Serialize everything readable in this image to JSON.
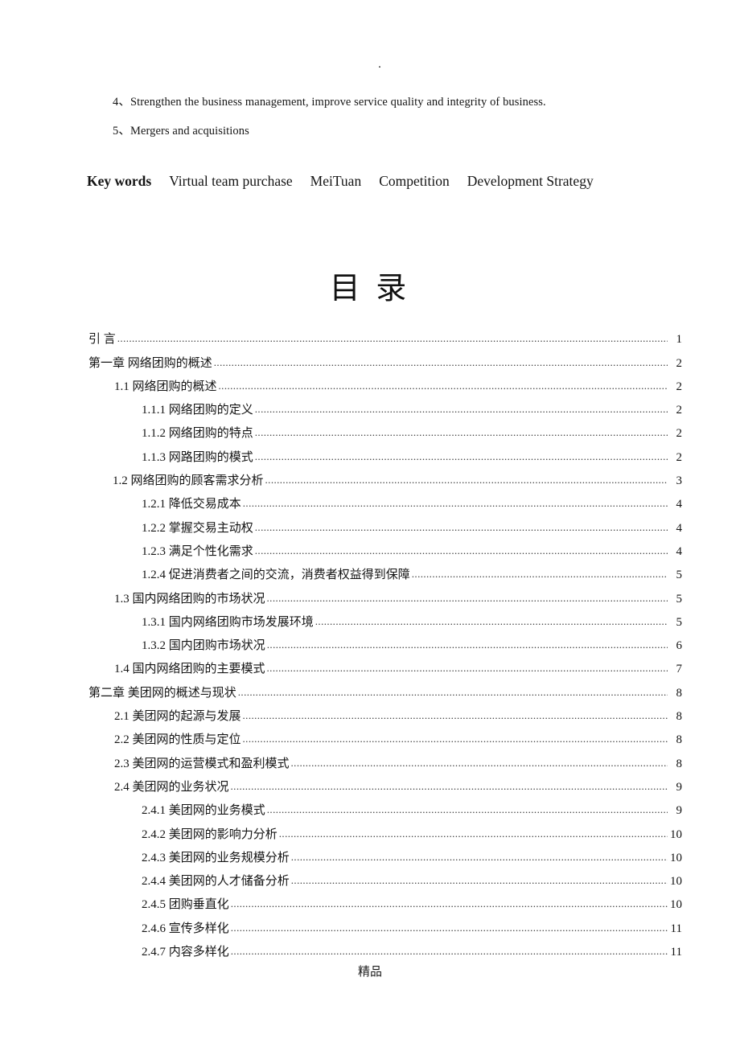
{
  "page": {
    "top_marker": ".",
    "footer_text": "精品"
  },
  "abstract_tail": {
    "lines": [
      "4、Strengthen the business management, improve service quality and integrity of business.",
      "5、Mergers and acquisitions"
    ]
  },
  "keywords": {
    "label": "Key words",
    "items": [
      "Virtual team purchase",
      "MeiTuan",
      "Competition",
      "Development Strategy"
    ]
  },
  "toc": {
    "heading": "目 录",
    "leader_char": ".",
    "entries": [
      {
        "level": 0,
        "title": "引   言",
        "page": "1"
      },
      {
        "level": 0,
        "title": "第一章  网络团购的概述",
        "page": "2"
      },
      {
        "level": 1,
        "title": "1.1  网络团购的概述",
        "page": "2"
      },
      {
        "level": 2,
        "title": "1.1.1 网络团购的定义",
        "page": "2"
      },
      {
        "level": 2,
        "title": "1.1.2 网络团购的特点",
        "page": "2"
      },
      {
        "level": 2,
        "title": "1.1.3 网路团购的模式",
        "page": "2"
      },
      {
        "level": 1,
        "title": "1.2 网络团购的顾客需求分析",
        "page": "3"
      },
      {
        "level": 2,
        "title": "1.2.1 降低交易成本",
        "page": "4"
      },
      {
        "level": 2,
        "title": "1.2.2 掌握交易主动权",
        "page": "4"
      },
      {
        "level": 2,
        "title": "1.2.3 满足个性化需求",
        "page": "4"
      },
      {
        "level": 2,
        "title": "1.2.4 促进消费者之间的交流，消费者权益得到保障",
        "page": "5"
      },
      {
        "level": 1,
        "title": "1.3  国内网络团购的市场状况",
        "page": "5"
      },
      {
        "level": 2,
        "title": "1.3.1 国内网络团购市场发展环境",
        "page": "5"
      },
      {
        "level": 2,
        "title": "1.3.2 国内团购市场状况",
        "page": "6"
      },
      {
        "level": 1,
        "title": "1.4  国内网络团购的主要模式",
        "page": "7"
      },
      {
        "level": 0,
        "title": "第二章  美团网的概述与现状",
        "page": "8"
      },
      {
        "level": 1,
        "title": "2.1  美团网的起源与发展",
        "page": "8"
      },
      {
        "level": 1,
        "title": "2.2  美团网的性质与定位",
        "page": "8"
      },
      {
        "level": 1,
        "title": "2.3  美团网的运营模式和盈利模式",
        "page": "8"
      },
      {
        "level": 1,
        "title": "2.4  美团网的业务状况",
        "page": "9"
      },
      {
        "level": 2,
        "title": "2.4.1 美团网的业务模式",
        "page": "9"
      },
      {
        "level": 2,
        "title": "2.4.2 美团网的影响力分析",
        "page": "10"
      },
      {
        "level": 2,
        "title": "2.4.3 美团网的业务规模分析",
        "page": "10"
      },
      {
        "level": 2,
        "title": "2.4.4 美团网的人才储备分析",
        "page": "10"
      },
      {
        "level": 2,
        "title": "2.4.5 团购垂直化",
        "page": "10"
      },
      {
        "level": 2,
        "title": "2.4.6 宣传多样化",
        "page": "11"
      },
      {
        "level": 2,
        "title": "2.4.7 内容多样化",
        "page": "11"
      }
    ]
  }
}
